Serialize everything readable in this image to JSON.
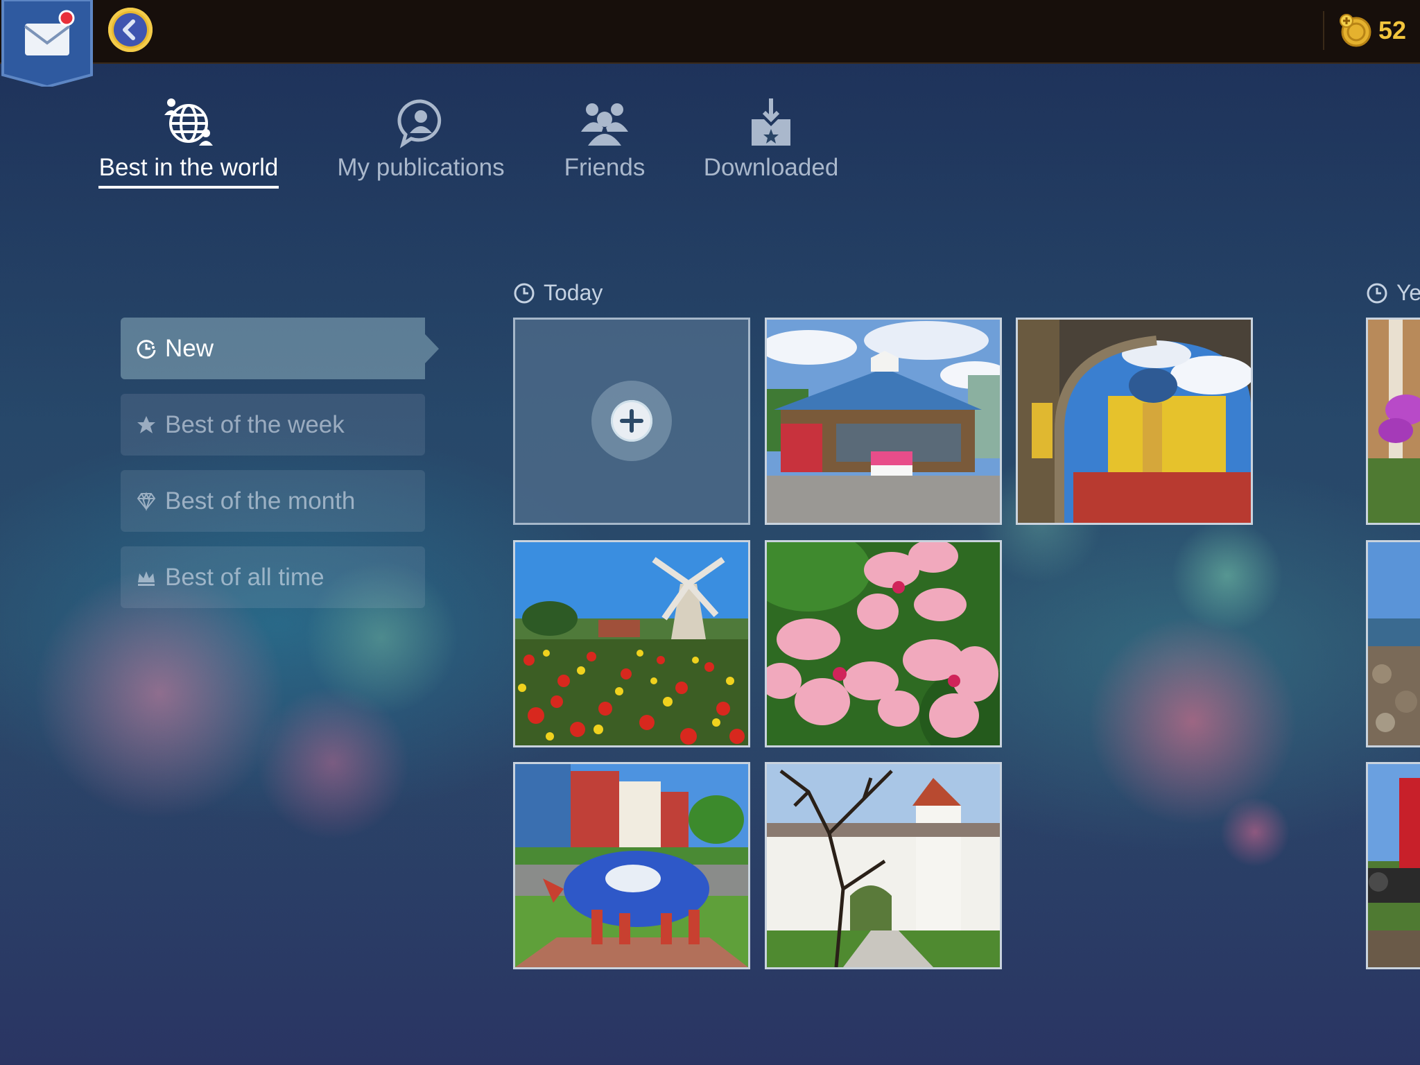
{
  "topbar": {
    "coins": "52",
    "mail_has_notification": true
  },
  "tabs": [
    {
      "label": "Best in the world",
      "icon": "globe-people-icon",
      "active": true
    },
    {
      "label": "My publications",
      "icon": "user-speech-icon",
      "active": false
    },
    {
      "label": "Friends",
      "icon": "friends-icon",
      "active": false
    },
    {
      "label": "Downloaded",
      "icon": "download-star-icon",
      "active": false
    }
  ],
  "filters": [
    {
      "label": "New",
      "icon": "clock-icon",
      "active": true
    },
    {
      "label": "Best of the week",
      "icon": "star-icon",
      "active": false
    },
    {
      "label": "Best of the month",
      "icon": "diamond-icon",
      "active": false
    },
    {
      "label": "Best of all time",
      "icon": "crown-icon",
      "active": false
    }
  ],
  "sections": [
    {
      "title": "Today",
      "tiles": [
        {
          "type": "add"
        },
        {
          "type": "image",
          "subject": "farm stand market"
        },
        {
          "type": "image",
          "subject": "yellow palace through arch"
        },
        {
          "type": "image",
          "subject": "windmill with poppy field"
        },
        {
          "type": "image",
          "subject": "pink flowers"
        },
        {
          "type": "image",
          "subject": "painted pig statue"
        },
        {
          "type": "image",
          "subject": "white castle gate"
        }
      ]
    },
    {
      "title": "Yes",
      "tiles": [
        {
          "type": "image",
          "subject": "purple flower"
        },
        {
          "type": "image",
          "subject": "rocky shore"
        },
        {
          "type": "image",
          "subject": "red train"
        }
      ]
    }
  ],
  "colors": {
    "topbar": "#170f0b",
    "coin": "#f2c53d",
    "mail_badge": "#2f5aa0",
    "notification_dot": "#e8303a"
  }
}
